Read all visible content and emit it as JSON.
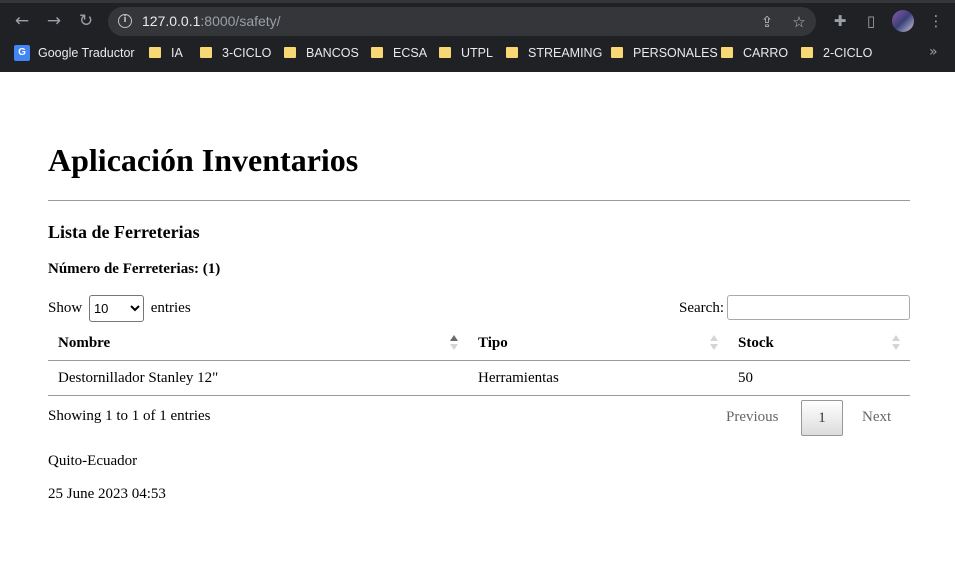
{
  "browser": {
    "url_host": "127.0.0.1",
    "url_path": ":8000/safety/",
    "bookmarks": [
      {
        "label": "Google Traductor",
        "icon": "google-translate-icon"
      },
      {
        "label": "IA",
        "icon": "folder-icon"
      },
      {
        "label": "3-CICLO",
        "icon": "folder-icon"
      },
      {
        "label": "BANCOS",
        "icon": "folder-icon"
      },
      {
        "label": "ECSA",
        "icon": "folder-icon"
      },
      {
        "label": "UTPL",
        "icon": "folder-icon"
      },
      {
        "label": "STREAMING",
        "icon": "folder-icon"
      },
      {
        "label": "PERSONALES",
        "icon": "folder-icon"
      },
      {
        "label": "CARRO",
        "icon": "folder-icon"
      },
      {
        "label": "2-CICLO",
        "icon": "folder-icon"
      }
    ],
    "bookmark_more": "»",
    "icons": {
      "back": "←",
      "forward": "→",
      "reload": "↻",
      "info": "i",
      "share": "⇪",
      "star": "☆",
      "extensions": "✚",
      "sidepanel": "▯",
      "menu": "⋮",
      "google_translate": "G"
    }
  },
  "page": {
    "title": "Aplicación Inventarios",
    "subtitle": "Lista de Ferreterias",
    "count_text": "Número de Ferreterias: (1)",
    "show_label": "Show",
    "entries_label": "entries",
    "page_length": "10",
    "search_label": "Search:",
    "search_value": "",
    "table": {
      "columns": [
        "Nombre",
        "Tipo",
        "Stock"
      ],
      "rows": [
        [
          "Destornillador Stanley 12\"",
          "Herramientas",
          "50"
        ]
      ]
    },
    "info_text": "Showing 1 to 1 of 1 entries",
    "pagination": {
      "previous": "Previous",
      "current": "1",
      "next": "Next"
    },
    "footer_location": "Quito-Ecuador",
    "footer_date": "25 June 2023 04:53"
  },
  "colors": {
    "chrome_bg": "#202124",
    "omnibox_bg": "#35363a",
    "folder": "#f8d775",
    "rule": "#9a9a9a"
  }
}
